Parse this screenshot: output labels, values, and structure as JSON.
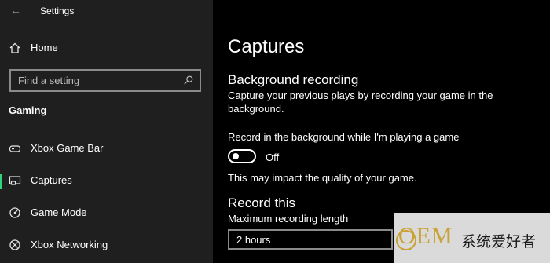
{
  "app": {
    "title": "Settings",
    "back_icon": "back-arrow-icon"
  },
  "sidebar": {
    "home": {
      "label": "Home",
      "icon": "home-icon"
    },
    "search": {
      "placeholder": "Find a setting",
      "icon": "search-icon"
    },
    "section": "Gaming",
    "items": [
      {
        "label": "Xbox Game Bar",
        "icon": "game-bar-icon",
        "selected": false
      },
      {
        "label": "Captures",
        "icon": "captures-icon",
        "selected": true
      },
      {
        "label": "Game Mode",
        "icon": "game-mode-icon",
        "selected": false
      },
      {
        "label": "Xbox Networking",
        "icon": "xbox-icon",
        "selected": false
      }
    ],
    "accent": "#2fd37a"
  },
  "main": {
    "title": "Captures",
    "background_recording": {
      "heading": "Background recording",
      "description": "Capture your previous plays by recording your game in the background.",
      "toggle_label": "Record in the background while I'm playing a game",
      "toggle_state": "Off",
      "note": "This may impact the quality of your game."
    },
    "record_this": {
      "heading": "Record this",
      "label": "Maximum recording length",
      "value": "2 hours"
    }
  },
  "watermark": {
    "brand": "OEM",
    "text": "系统爱好者"
  }
}
